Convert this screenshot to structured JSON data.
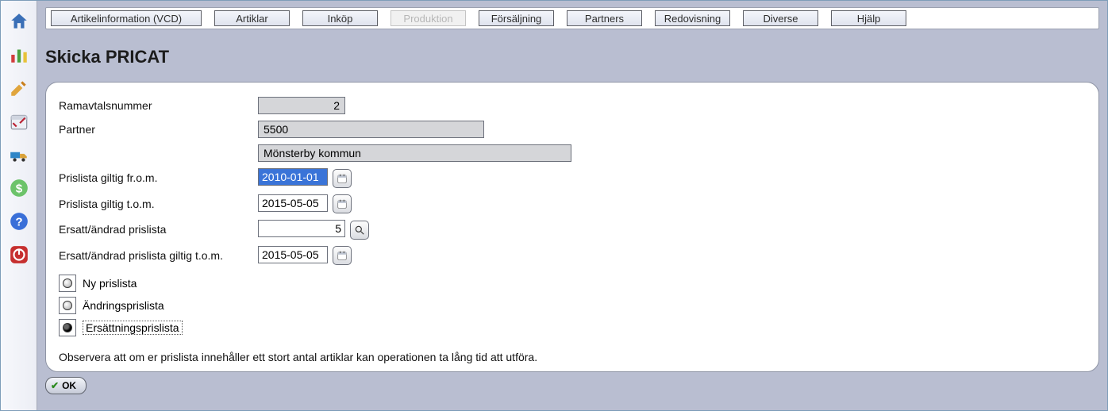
{
  "tabs": [
    {
      "label": "Artikelinformation (VCD)",
      "disabled": false,
      "wide": true
    },
    {
      "label": "Artiklar",
      "disabled": false
    },
    {
      "label": "Inköp",
      "disabled": false
    },
    {
      "label": "Produktion",
      "disabled": true
    },
    {
      "label": "Försäljning",
      "disabled": false
    },
    {
      "label": "Partners",
      "disabled": false
    },
    {
      "label": "Redovisning",
      "disabled": false
    },
    {
      "label": "Diverse",
      "disabled": false
    },
    {
      "label": "Hjälp",
      "disabled": false
    }
  ],
  "page": {
    "title": "Skicka PRICAT"
  },
  "form": {
    "ramavtalsnummer": {
      "label": "Ramavtalsnummer",
      "value": "2"
    },
    "partner": {
      "label": "Partner",
      "code": "5500",
      "name": "Mönsterby kommun"
    },
    "giltig_from": {
      "label": "Prislista giltig fr.o.m.",
      "value": "2010-01-01"
    },
    "giltig_tom": {
      "label": "Prislista giltig t.o.m.",
      "value": "2015-05-05"
    },
    "ersatt": {
      "label": "Ersatt/ändrad prislista",
      "value": "5"
    },
    "ersatt_tom": {
      "label": "Ersatt/ändrad prislista giltig t.o.m.",
      "value": "2015-05-05"
    }
  },
  "radios": {
    "ny": {
      "label": "Ny prislista",
      "checked": false
    },
    "andring": {
      "label": "Ändringsprislista",
      "checked": false
    },
    "ersattning": {
      "label": "Ersättningsprislista",
      "checked": true
    }
  },
  "note": "Observera att om er prislista innehåller ett stort antal artiklar kan operationen ta lång tid att utföra.",
  "buttons": {
    "ok": "OK"
  }
}
